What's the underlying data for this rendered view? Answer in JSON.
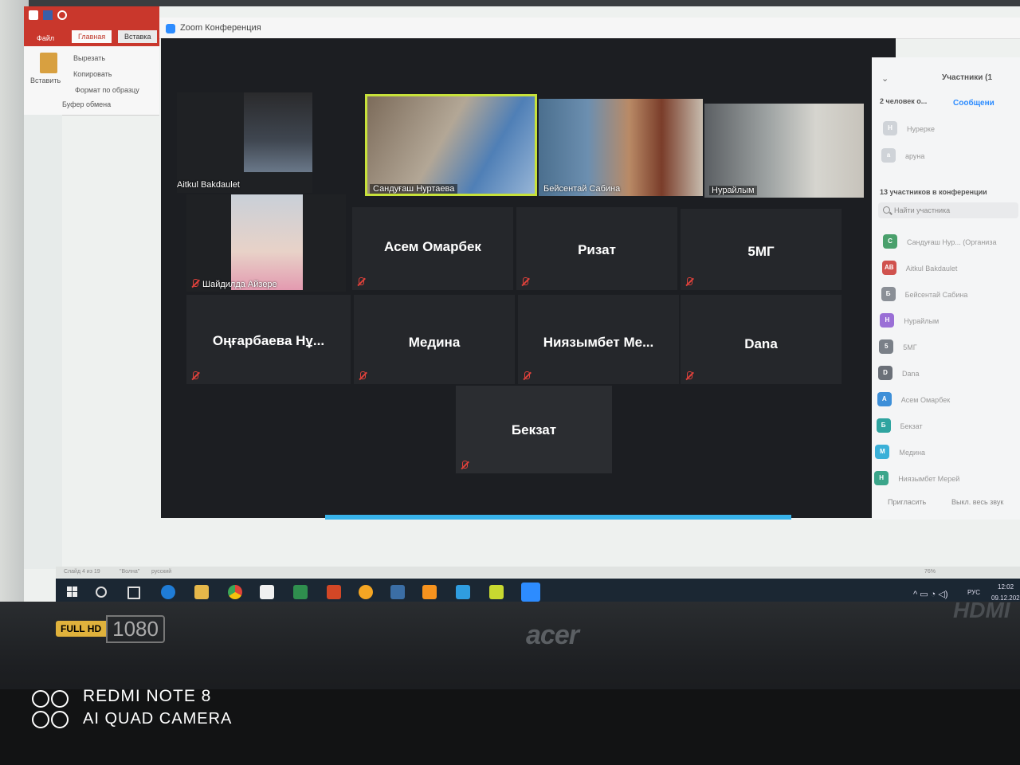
{
  "ppt": {
    "tabs": [
      "Файл",
      "Главная",
      "Вставка"
    ],
    "ribbon": {
      "paste": "Вставить",
      "cut": "Вырезать",
      "copy": "Копировать",
      "format_painter": "Формат по образцу",
      "group": "Буфер обмена"
    },
    "status": {
      "slide": "Слайд 4 из 19",
      "theme": "\"Волна\"",
      "language": "русский",
      "zoom": "76%"
    }
  },
  "zoom": {
    "title": "Zoom Конференция",
    "video_tiles": [
      {
        "name": "Aitkul Bakdaulet"
      },
      {
        "name": "Сандуғаш Нуртаева",
        "active": true
      },
      {
        "name": "Бейсентай Сабина"
      },
      {
        "name": "Нурайлым"
      },
      {
        "name": "Шайдилда Айзере"
      }
    ],
    "name_tiles": [
      "Асем Омарбек",
      "Ризат",
      "5МГ",
      "Оңғарбаева Нұ...",
      "Медина",
      "Ниязымбет Ме...",
      "Dana",
      "Бекзат"
    ],
    "panel": {
      "title": "Участники (1",
      "waiting": "2 человек о...",
      "message_link": "Сообщени",
      "waiting_list": [
        "Нурерке",
        "аруна"
      ],
      "in_meeting": "13 участников в конференции",
      "search_placeholder": "Найти участника",
      "participants": [
        {
          "initials": "С",
          "name": "Сандуғаш Нур...  (Организа",
          "color": "#4aa06c"
        },
        {
          "initials": "AB",
          "name": "Aitkul Bakdaulet",
          "color": "#d0524e"
        },
        {
          "initials": "Б",
          "name": "Бейсентай Сабина",
          "color": "#8a8f96"
        },
        {
          "initials": "Н",
          "name": "Нурайлым",
          "color": "#9a6fd6"
        },
        {
          "initials": "5",
          "name": "5МГ",
          "color": "#7a8088"
        },
        {
          "initials": "D",
          "name": "Dana",
          "color": "#6b7078"
        },
        {
          "initials": "А",
          "name": "Асем Омарбек",
          "color": "#3d8fd8"
        },
        {
          "initials": "Б",
          "name": "Бекзат",
          "color": "#2fa4a0"
        },
        {
          "initials": "М",
          "name": "Медина",
          "color": "#3ab0d8"
        },
        {
          "initials": "Н",
          "name": "Ниязымбет Мерей",
          "color": "#3ba58a"
        }
      ],
      "invite": "Пригласить",
      "mute_all": "Выкл. весь звук"
    }
  },
  "taskbar": {
    "language": "РУС",
    "time": "12:02",
    "date": "09.12.2020"
  },
  "device": {
    "hd_full": "FULL HD",
    "hd_res": "1080",
    "brand": "acer",
    "port": "HDMI"
  },
  "watermark": {
    "line1": "REDMI NOTE 8",
    "line2": "AI QUAD CAMERA"
  }
}
